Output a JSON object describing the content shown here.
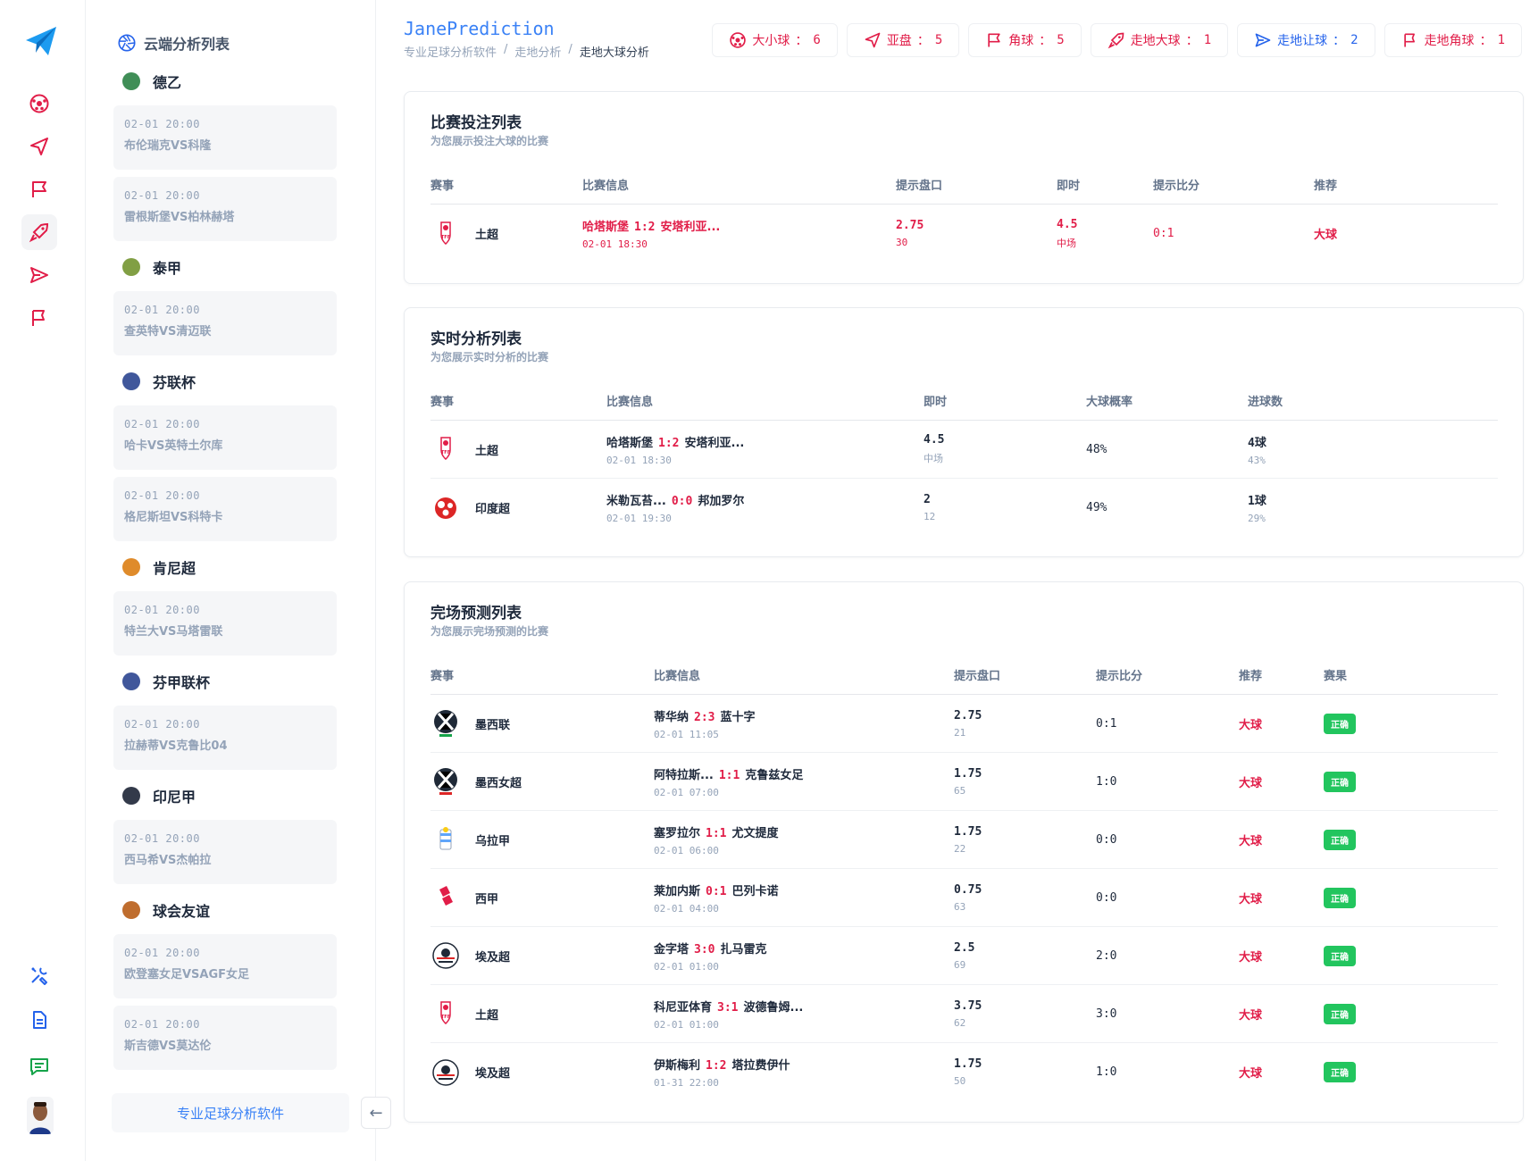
{
  "app": {
    "brand": "JanePrediction"
  },
  "breadcrumb": [
    "专业足球分析软件",
    "走地分析",
    "走地大球分析"
  ],
  "chips": [
    {
      "label": "大小球",
      "count": "6",
      "icon": "soccer-ball-icon",
      "color": "#e11d48"
    },
    {
      "label": "亚盘",
      "count": "5",
      "icon": "send-icon",
      "color": "#e11d48"
    },
    {
      "label": "角球",
      "count": "5",
      "icon": "flag-icon",
      "color": "#e11d48"
    },
    {
      "label": "走地大球",
      "count": "1",
      "icon": "rocket-icon",
      "color": "#e11d48"
    },
    {
      "label": "走地让球",
      "count": "2",
      "icon": "paper-plane-icon",
      "color": "#2563eb"
    },
    {
      "label": "走地角球",
      "count": "1",
      "icon": "flag-outline-icon",
      "color": "#e11d48"
    }
  ],
  "sidebar": {
    "title": "云端分析列表",
    "footer_button": "专业足球分析软件",
    "groups": [
      {
        "league": "德乙",
        "matches": [
          {
            "time": "02-01 20:00",
            "teams": "布伦瑞克VS科隆"
          },
          {
            "time": "02-01 20:00",
            "teams": "雷根斯堡VS柏林赫塔"
          }
        ]
      },
      {
        "league": "泰甲",
        "matches": [
          {
            "time": "02-01 20:00",
            "teams": "查英特VS清迈联"
          }
        ]
      },
      {
        "league": "芬联杯",
        "matches": [
          {
            "time": "02-01 20:00",
            "teams": "哈卡VS英特土尔库"
          },
          {
            "time": "02-01 20:00",
            "teams": "格尼斯坦VS科特卡"
          }
        ]
      },
      {
        "league": "肯尼超",
        "matches": [
          {
            "time": "02-01 20:00",
            "teams": "特兰大VS马塔雷联"
          }
        ]
      },
      {
        "league": "芬甲联杯",
        "matches": [
          {
            "time": "02-01 20:00",
            "teams": "拉赫蒂VS克鲁比04"
          }
        ]
      },
      {
        "league": "印尼甲",
        "matches": [
          {
            "time": "02-01 20:00",
            "teams": "西马希VS杰帕拉"
          }
        ]
      },
      {
        "league": "球会友谊",
        "matches": [
          {
            "time": "02-01 20:00",
            "teams": "欧登塞女足VSAGF女足"
          },
          {
            "time": "02-01 20:00",
            "teams": "斯吉德VS莫达伦"
          }
        ]
      }
    ]
  },
  "bet_panel": {
    "title": "比赛投注列表",
    "subtitle": "为您展示投注大球的比赛",
    "headers": [
      "赛事",
      "比赛信息",
      "提示盘口",
      "即时",
      "提示比分",
      "推荐"
    ],
    "rows": [
      {
        "league": "土超",
        "home": "哈塔斯堡",
        "score": "1:2",
        "away": "安塔利亚...",
        "time": "02-01 18:30",
        "line": "2.75",
        "line_sub": "30",
        "live": "4.5",
        "live_sub": "中场",
        "tip_score": "0:1",
        "rec": "大球"
      }
    ]
  },
  "live_panel": {
    "title": "实时分析列表",
    "subtitle": "为您展示实时分析的比赛",
    "headers": [
      "赛事",
      "比赛信息",
      "即时",
      "大球概率",
      "进球数"
    ],
    "rows": [
      {
        "league": "土超",
        "home": "哈塔斯堡",
        "score": "1:2",
        "away": "安塔利亚...",
        "time": "02-01 18:30",
        "live": "4.5",
        "live_sub": "中场",
        "prob": "48%",
        "goals": "4球",
        "goals_sub": "43%"
      },
      {
        "league": "印度超",
        "home": "米勒瓦苔...",
        "score": "0:0",
        "away": "邦加罗尔",
        "time": "02-01 19:30",
        "live": "2",
        "live_sub": "12",
        "prob": "49%",
        "goals": "1球",
        "goals_sub": "29%"
      }
    ]
  },
  "final_panel": {
    "title": "完场预测列表",
    "subtitle": "为您展示完场预测的比赛",
    "headers": [
      "赛事",
      "比赛信息",
      "提示盘口",
      "提示比分",
      "推荐",
      "赛果"
    ],
    "rows": [
      {
        "league": "墨西联",
        "home": "蒂华纳",
        "score": "2:3",
        "away": "蓝十字",
        "time": "02-01 11:05",
        "line": "2.75",
        "line_sub": "21",
        "tip_score": "0:1",
        "rec": "大球",
        "result": "正确"
      },
      {
        "league": "墨西女超",
        "home": "阿特拉斯...",
        "score": "1:1",
        "away": "克鲁兹女足",
        "time": "02-01 07:00",
        "line": "1.75",
        "line_sub": "65",
        "tip_score": "1:0",
        "rec": "大球",
        "result": "正确"
      },
      {
        "league": "乌拉甲",
        "home": "塞罗拉尔",
        "score": "1:1",
        "away": "尤文提度",
        "time": "02-01 06:00",
        "line": "1.75",
        "line_sub": "22",
        "tip_score": "0:0",
        "rec": "大球",
        "result": "正确"
      },
      {
        "league": "西甲",
        "home": "莱加内斯",
        "score": "0:1",
        "away": "巴列卡诺",
        "time": "02-01 04:00",
        "line": "0.75",
        "line_sub": "63",
        "tip_score": "0:0",
        "rec": "大球",
        "result": "正确"
      },
      {
        "league": "埃及超",
        "home": "金字塔",
        "score": "3:0",
        "away": "扎马雷克",
        "time": "02-01 01:00",
        "line": "2.5",
        "line_sub": "69",
        "tip_score": "2:0",
        "rec": "大球",
        "result": "正确"
      },
      {
        "league": "土超",
        "home": "科尼亚体育",
        "score": "3:1",
        "away": "波德鲁姆...",
        "time": "02-01 01:00",
        "line": "3.75",
        "line_sub": "62",
        "tip_score": "3:0",
        "rec": "大球",
        "result": "正确"
      },
      {
        "league": "埃及超",
        "home": "伊斯梅利",
        "score": "1:2",
        "away": "塔拉费伊什",
        "time": "01-31 22:00",
        "line": "1.75",
        "line_sub": "50",
        "tip_score": "1:0",
        "rec": "大球",
        "result": "正确"
      }
    ]
  }
}
